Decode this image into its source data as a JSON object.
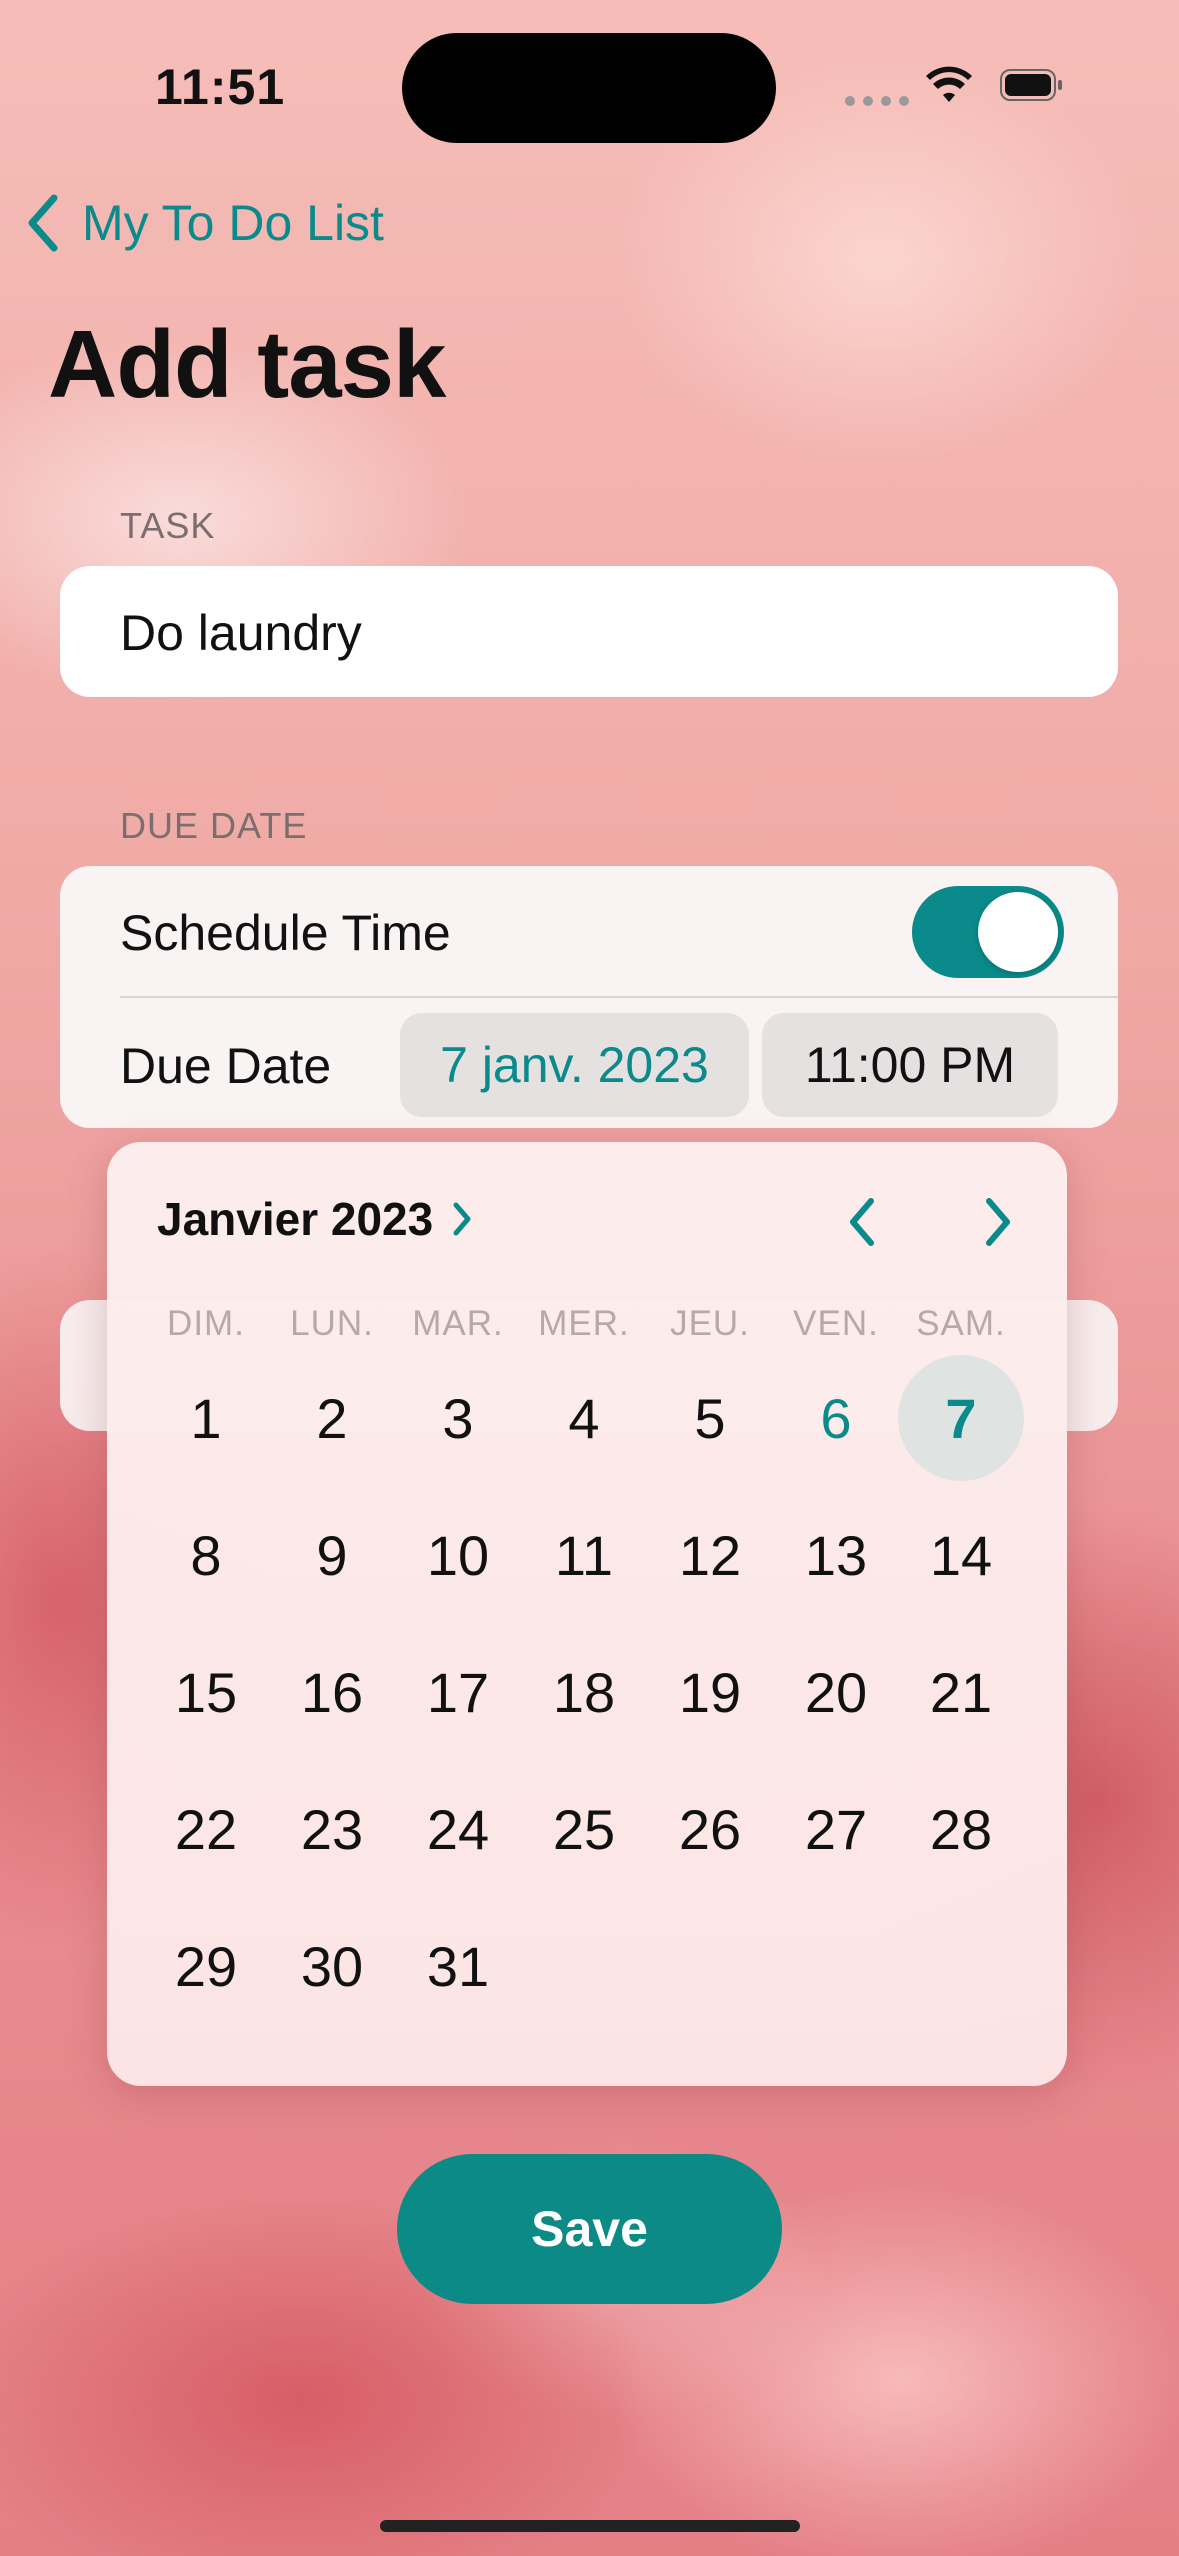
{
  "status_bar": {
    "time": "11:51"
  },
  "nav": {
    "back_label": "My To Do List"
  },
  "page": {
    "title": "Add task"
  },
  "task_section": {
    "label": "TASK",
    "value": "Do laundry"
  },
  "due_section": {
    "label": "DUE DATE",
    "schedule_label": "Schedule Time",
    "schedule_on": true,
    "due_label": "Due Date",
    "date_value": "7 janv. 2023",
    "time_value": "11:00 PM"
  },
  "calendar": {
    "month_label": "Janvier 2023",
    "weekdays": [
      "DIM.",
      "LUN.",
      "MAR.",
      "MER.",
      "JEU.",
      "VEN.",
      "SAM."
    ],
    "weeks": [
      [
        "1",
        "2",
        "3",
        "4",
        "5",
        "6",
        "7"
      ],
      [
        "8",
        "9",
        "10",
        "11",
        "12",
        "13",
        "14"
      ],
      [
        "15",
        "16",
        "17",
        "18",
        "19",
        "20",
        "21"
      ],
      [
        "22",
        "23",
        "24",
        "25",
        "26",
        "27",
        "28"
      ],
      [
        "29",
        "30",
        "31"
      ]
    ],
    "today": "6",
    "selected": "7"
  },
  "actions": {
    "save_label": "Save"
  },
  "colors": {
    "accent": "#0a8a8a",
    "save": "#0b8a86"
  }
}
